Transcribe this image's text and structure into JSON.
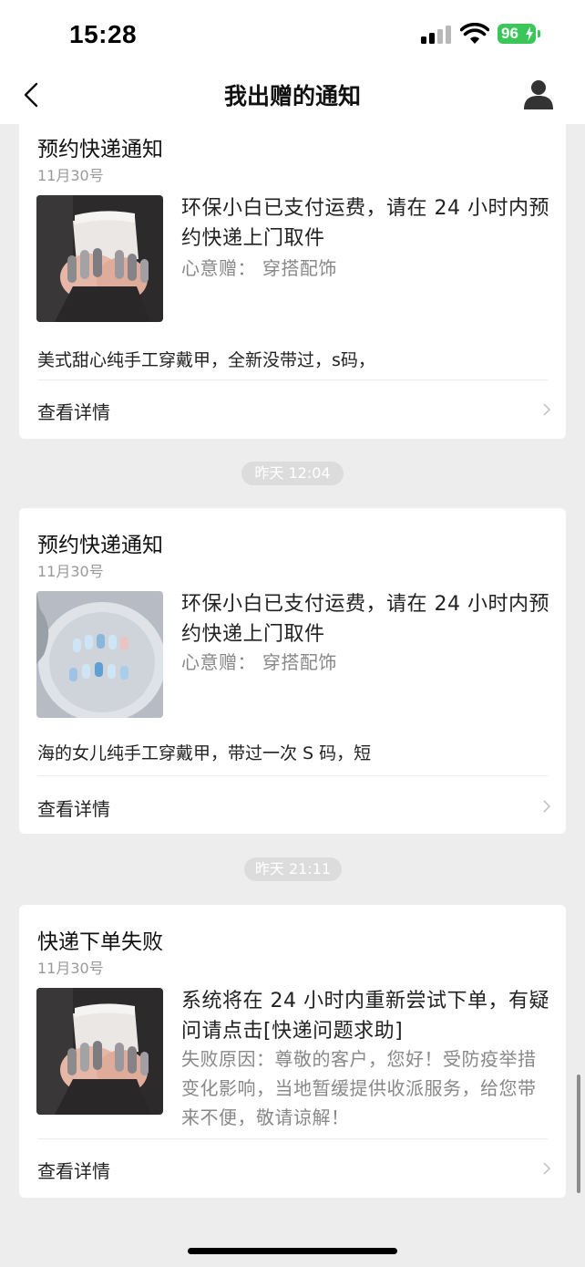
{
  "status_bar": {
    "time": "15:28",
    "battery": "96"
  },
  "nav": {
    "title": "我出赠的通知"
  },
  "cards": [
    {
      "title": "预约快递通知",
      "date": "11月30号",
      "message": "环保小白已支付运费，请在 24 小时内预约快递上门取件",
      "sub": "心意赠：  穿搭配饰",
      "description": "美式甜心纯手工穿戴甲，全新没带过，s码，",
      "action": "查看详情",
      "image_icon": "nail-photo-mug"
    },
    {
      "title": "预约快递通知",
      "date": "11月30号",
      "message": "环保小白已支付运费，请在 24 小时内预约快递上门取件",
      "sub": "心意赠：  穿搭配饰",
      "description": "海的女儿纯手工穿戴甲，带过一次 S 码，短",
      "action": "查看详情",
      "image_icon": "nail-photo-tray"
    },
    {
      "title": "快递下单失败",
      "date": "11月30号",
      "message": "系统将在 24 小时内重新尝试下单，有疑问请点击[快递问题求助]",
      "sub": "失败原因：尊敬的客户，您好！受防疫举措变化影响，当地暂缓提供收派服务，给您带来不便，敬请谅解！",
      "action": "查看详情",
      "image_icon": "nail-photo-mug"
    }
  ],
  "timestamps": [
    "昨天 12:04",
    "昨天 21:11"
  ],
  "colors": {
    "battery_green": "#3ac659",
    "page_bg": "#ededed",
    "card_bg": "#ffffff",
    "badge_bg": "#dcdcdc"
  }
}
